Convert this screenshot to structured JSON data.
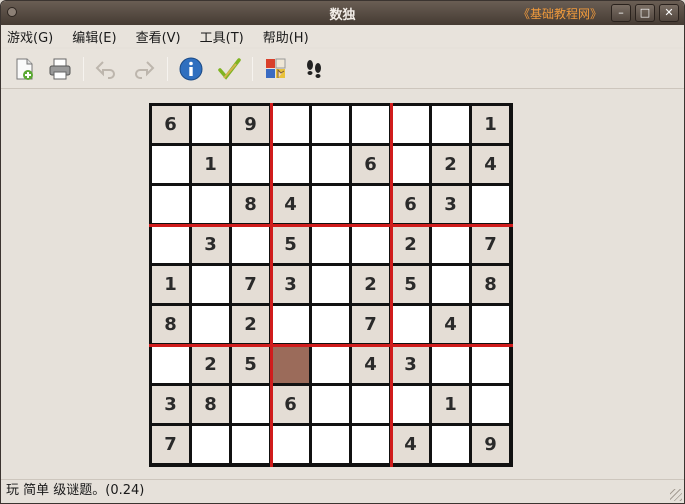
{
  "window": {
    "title": "数独",
    "watermark": "《基础教程网》",
    "minimize": "–",
    "maximize": "□",
    "close": "✕"
  },
  "menu": [
    {
      "label": "游戏(G)"
    },
    {
      "label": "编辑(E)"
    },
    {
      "label": "查看(V)"
    },
    {
      "label": "工具(T)"
    },
    {
      "label": "帮助(H)"
    }
  ],
  "toolbar": {
    "items": [
      "new-game-icon",
      "print-icon",
      "undo-icon",
      "redo-icon",
      "info-icon",
      "check-icon",
      "hints-icon",
      "track-icon"
    ]
  },
  "board": {
    "rows": [
      [
        "6",
        "",
        "9",
        "",
        "",
        "",
        "",
        "",
        "1"
      ],
      [
        "",
        "1",
        "",
        "",
        "",
        "6",
        "",
        "2",
        "4"
      ],
      [
        "",
        "",
        "8",
        "4",
        "",
        "",
        "6",
        "3",
        ""
      ],
      [
        "",
        "3",
        "",
        "5",
        "",
        "",
        "2",
        "",
        "7"
      ],
      [
        "1",
        "",
        "7",
        "3",
        "",
        "2",
        "5",
        "",
        "8"
      ],
      [
        "8",
        "",
        "2",
        "",
        "",
        "7",
        "",
        "4",
        ""
      ],
      [
        "",
        "2",
        "5",
        "",
        "",
        "4",
        "3",
        "",
        ""
      ],
      [
        "3",
        "8",
        "",
        "6",
        "",
        "",
        "",
        "1",
        ""
      ],
      [
        "7",
        "",
        "",
        "",
        "",
        "",
        "4",
        "",
        "9"
      ]
    ],
    "selected": {
      "row": 6,
      "col": 3
    },
    "colors": {
      "given": "#e4ddd5",
      "empty": "#ffffff",
      "selected": "#9b6b5a",
      "divider": "#d01c1c"
    }
  },
  "status": {
    "text": "玩 简单 级谜题。(0.24)"
  }
}
